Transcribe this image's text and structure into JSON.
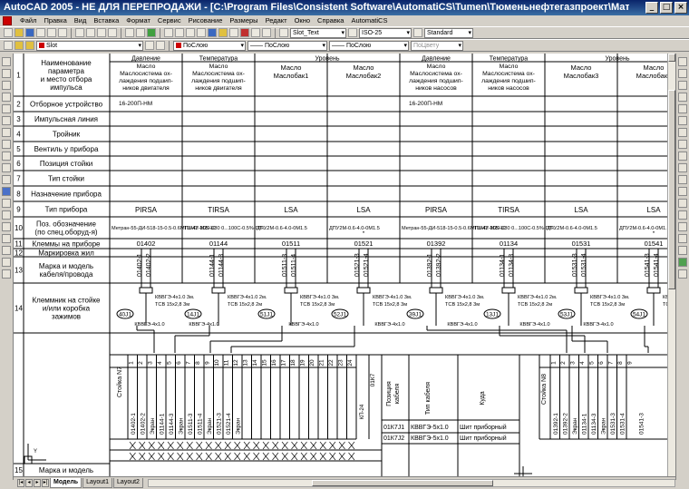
{
  "window": {
    "title": "AutoCAD 2005 - НЕ ДЛЯ ПЕРЕПРОДАЖИ - [C:\\Program Files\\Consistent Software\\AutomatiCS\\Tumen\\Тюменьнефтегазпроект\\Материалы по...",
    "min": "_",
    "max": "□",
    "close": "×"
  },
  "menu": [
    "Файл",
    "Правка",
    "Вид",
    "Вставка",
    "Формат",
    "Сервис",
    "Рисование",
    "Размеры",
    "Редакт",
    "Окно",
    "Справка",
    "AutomatiCS"
  ],
  "toolbar": {
    "text_style": "Slot_Text",
    "dim_style": "ISO-25",
    "table_style": "Standard",
    "layer": "Slot",
    "color": "ПоСлою",
    "linetype": "ПоСлою",
    "lineweight": "ПоСлою",
    "plotstyle": "ПоЦвету"
  },
  "tabs": [
    "Модель",
    "Layout1",
    "Layout2"
  ],
  "sheet": {
    "row_labels": [
      {
        "n": "1",
        "t": [
          "Наименование",
          "параметра",
          "и место отбора",
          "импульса"
        ]
      },
      {
        "n": "2",
        "t": [
          "Отборное устройство"
        ]
      },
      {
        "n": "3",
        "t": [
          "Импульсная линия"
        ]
      },
      {
        "n": "4",
        "t": [
          "Тройник"
        ]
      },
      {
        "n": "5",
        "t": [
          "Вентиль у прибора"
        ]
      },
      {
        "n": "6",
        "t": [
          "Позиция стойки"
        ]
      },
      {
        "n": "7",
        "t": [
          "Тип стойки"
        ]
      },
      {
        "n": "8",
        "t": [
          "Назначение прибора"
        ]
      },
      {
        "n": "9",
        "t": [
          "Тип прибора"
        ]
      },
      {
        "n": "10",
        "t": [
          "Поз. обозначение",
          "(по спец.оборуд-я)"
        ]
      },
      {
        "n": "11",
        "t": [
          "Клеммы на приборе"
        ]
      },
      {
        "n": "12",
        "t": [
          "Маркировка жил"
        ]
      },
      {
        "n": "13",
        "t": [
          "Марка и модель",
          "кабеля/провода"
        ]
      },
      {
        "n": "14",
        "t": [
          "Клеммник на стойке",
          "и/или коробка",
          "зажимов"
        ]
      },
      {
        "n": "15",
        "t": [
          "Марка и модель"
        ]
      }
    ],
    "groups": [
      "Давление",
      "Температура",
      "Уровень",
      "Давление",
      "Температура",
      "Уровень"
    ],
    "cols": [
      {
        "top": [
          "Масло",
          "Маслосистема ох-",
          "лаждения подшип-",
          "ников двигателя"
        ],
        "dev": "16-200П-НМ",
        "purpose": "PIRSA",
        "type": "Метран-55-ДИ-518-15-0.5-0.6МПа-42-М20-С",
        "pos": "01402",
        "wires": [
          "01402-1",
          "01402-2"
        ]
      },
      {
        "top": [
          "Масло",
          "Маслосистема ох-",
          "лаждения подшип-",
          "ников двигателя"
        ],
        "dev": "",
        "purpose": "TIRSA",
        "type": "ТСМУ-205-1/80 0...100С-0.5%-ГП-...",
        "pos": "01144",
        "wires": [
          "01144-1",
          "01144-3"
        ]
      },
      {
        "top": [
          "Масло",
          "Маслобак1"
        ],
        "dev": "",
        "purpose": "LSA",
        "type": "ДПУ2М-0.6-4.0-0М1.5",
        "pos": "01511",
        "wires": [
          "01511-3",
          "01511-4"
        ]
      },
      {
        "top": [
          "Масло",
          "Маслобак2"
        ],
        "dev": "",
        "purpose": "LSA",
        "type": "ДПУ2М-0.6-4.0-0М1.5",
        "pos": "01521",
        "wires": [
          "01521-3",
          "01521-4"
        ]
      },
      {
        "top": [
          "Масло",
          "Маслосистема ох-",
          "лаждения подшип-",
          "ников насосов"
        ],
        "dev": "16-200П-НМ",
        "purpose": "PIRSA",
        "type": "Метран-55-ДИ-518-15-0.5-0.6МПа-42-М20-С",
        "pos": "01392",
        "wires": [
          "01392-1",
          "01392-2"
        ]
      },
      {
        "top": [
          "Масло",
          "Маслосистема ох-",
          "лаждения подшип-",
          "ников насосов"
        ],
        "dev": "",
        "purpose": "TIRSA",
        "type": "ТСМУ-205-1/80 0...100С-0.5%-ГП-...",
        "pos": "01134",
        "wires": [
          "01134-1",
          "01134-3"
        ]
      },
      {
        "top": [
          "Масло",
          "Маслобак3"
        ],
        "dev": "",
        "purpose": "LSA",
        "type": "ДПУ2М-0.6-4.0-0М1.5",
        "pos": "01531",
        "wires": [
          "01531-3",
          "01531-4"
        ]
      },
      {
        "top": [
          "Масло",
          "Маслобак4"
        ],
        "dev": "",
        "purpose": "LSA",
        "type": "ДПУ2М-0.6-4.0-0М1.5",
        "pos": "01541",
        "wires": [
          "01541-3",
          "01541-4"
        ]
      }
    ],
    "ditto": "\"",
    "cable_tags": [
      "40J1",
      "14J1",
      "51J1",
      "52J1",
      "39J1",
      "13J1",
      "53J1",
      "54J1"
    ],
    "cable_spec1": "КВВГЭ-4х1.0  3м.",
    "cable_spec1b": "КВВГЭ-4х1.0  2м.",
    "cable_spec2": "ТСВ 15х2,8  3м",
    "cable_spec2b": "ТСВ 15х2,8  2м",
    "trunk_label": "КВВГЭ-4х1.0",
    "rack1": "Стойка N7",
    "rack2": "Стойка N8",
    "screen": "Экран",
    "terminal_nums": [
      "1",
      "2",
      "3",
      "4",
      "5",
      "6",
      "7",
      "8",
      "9",
      "10",
      "11",
      "12",
      "13",
      "14",
      "15",
      "16",
      "17",
      "18",
      "19",
      "20",
      "21",
      "22",
      "23",
      "24"
    ],
    "rack1_wires": [
      "01402-1",
      "01402-2",
      "01144-1",
      "01144-3",
      "01511-3",
      "01511-4",
      "01521-3",
      "01521-4"
    ],
    "kp": "КП-24",
    "kp_num": "01К7",
    "cable_table": {
      "h1": [
        "Позиция",
        "кабеля"
      ],
      "h2": "Тип кабеля",
      "h3": "Куда",
      "rows": [
        {
          "pos": "01К7J1",
          "type": "КВВГЭ-5х1.0",
          "to": "Шит приборный"
        },
        {
          "pos": "01К7J2",
          "type": "КВВГЭ-5х1.0",
          "to": "Шит приборный"
        }
      ]
    },
    "rack2_wires": [
      "01392-1",
      "01392-2",
      "01134-1",
      "01134-3",
      "01531-3",
      "01531-4",
      "01541-3"
    ]
  }
}
